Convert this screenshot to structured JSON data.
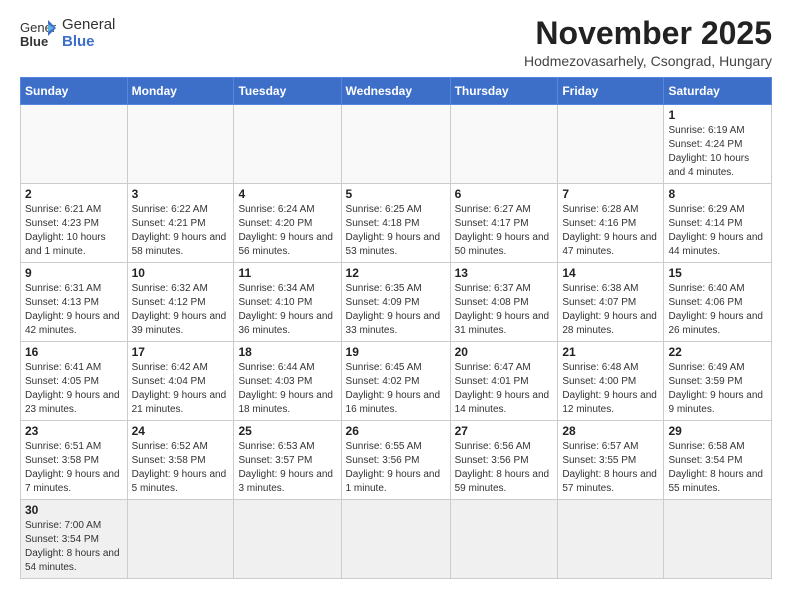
{
  "logo": {
    "text_normal": "General",
    "text_bold": "Blue"
  },
  "header": {
    "month": "November 2025",
    "location": "Hodmezovasarhely, Csongrad, Hungary"
  },
  "weekdays": [
    "Sunday",
    "Monday",
    "Tuesday",
    "Wednesday",
    "Thursday",
    "Friday",
    "Saturday"
  ],
  "weeks": [
    [
      {
        "day": "",
        "info": ""
      },
      {
        "day": "",
        "info": ""
      },
      {
        "day": "",
        "info": ""
      },
      {
        "day": "",
        "info": ""
      },
      {
        "day": "",
        "info": ""
      },
      {
        "day": "",
        "info": ""
      },
      {
        "day": "1",
        "info": "Sunrise: 6:19 AM\nSunset: 4:24 PM\nDaylight: 10 hours and 4 minutes."
      }
    ],
    [
      {
        "day": "2",
        "info": "Sunrise: 6:21 AM\nSunset: 4:23 PM\nDaylight: 10 hours and 1 minute."
      },
      {
        "day": "3",
        "info": "Sunrise: 6:22 AM\nSunset: 4:21 PM\nDaylight: 9 hours and 58 minutes."
      },
      {
        "day": "4",
        "info": "Sunrise: 6:24 AM\nSunset: 4:20 PM\nDaylight: 9 hours and 56 minutes."
      },
      {
        "day": "5",
        "info": "Sunrise: 6:25 AM\nSunset: 4:18 PM\nDaylight: 9 hours and 53 minutes."
      },
      {
        "day": "6",
        "info": "Sunrise: 6:27 AM\nSunset: 4:17 PM\nDaylight: 9 hours and 50 minutes."
      },
      {
        "day": "7",
        "info": "Sunrise: 6:28 AM\nSunset: 4:16 PM\nDaylight: 9 hours and 47 minutes."
      },
      {
        "day": "8",
        "info": "Sunrise: 6:29 AM\nSunset: 4:14 PM\nDaylight: 9 hours and 44 minutes."
      }
    ],
    [
      {
        "day": "9",
        "info": "Sunrise: 6:31 AM\nSunset: 4:13 PM\nDaylight: 9 hours and 42 minutes."
      },
      {
        "day": "10",
        "info": "Sunrise: 6:32 AM\nSunset: 4:12 PM\nDaylight: 9 hours and 39 minutes."
      },
      {
        "day": "11",
        "info": "Sunrise: 6:34 AM\nSunset: 4:10 PM\nDaylight: 9 hours and 36 minutes."
      },
      {
        "day": "12",
        "info": "Sunrise: 6:35 AM\nSunset: 4:09 PM\nDaylight: 9 hours and 33 minutes."
      },
      {
        "day": "13",
        "info": "Sunrise: 6:37 AM\nSunset: 4:08 PM\nDaylight: 9 hours and 31 minutes."
      },
      {
        "day": "14",
        "info": "Sunrise: 6:38 AM\nSunset: 4:07 PM\nDaylight: 9 hours and 28 minutes."
      },
      {
        "day": "15",
        "info": "Sunrise: 6:40 AM\nSunset: 4:06 PM\nDaylight: 9 hours and 26 minutes."
      }
    ],
    [
      {
        "day": "16",
        "info": "Sunrise: 6:41 AM\nSunset: 4:05 PM\nDaylight: 9 hours and 23 minutes."
      },
      {
        "day": "17",
        "info": "Sunrise: 6:42 AM\nSunset: 4:04 PM\nDaylight: 9 hours and 21 minutes."
      },
      {
        "day": "18",
        "info": "Sunrise: 6:44 AM\nSunset: 4:03 PM\nDaylight: 9 hours and 18 minutes."
      },
      {
        "day": "19",
        "info": "Sunrise: 6:45 AM\nSunset: 4:02 PM\nDaylight: 9 hours and 16 minutes."
      },
      {
        "day": "20",
        "info": "Sunrise: 6:47 AM\nSunset: 4:01 PM\nDaylight: 9 hours and 14 minutes."
      },
      {
        "day": "21",
        "info": "Sunrise: 6:48 AM\nSunset: 4:00 PM\nDaylight: 9 hours and 12 minutes."
      },
      {
        "day": "22",
        "info": "Sunrise: 6:49 AM\nSunset: 3:59 PM\nDaylight: 9 hours and 9 minutes."
      }
    ],
    [
      {
        "day": "23",
        "info": "Sunrise: 6:51 AM\nSunset: 3:58 PM\nDaylight: 9 hours and 7 minutes."
      },
      {
        "day": "24",
        "info": "Sunrise: 6:52 AM\nSunset: 3:58 PM\nDaylight: 9 hours and 5 minutes."
      },
      {
        "day": "25",
        "info": "Sunrise: 6:53 AM\nSunset: 3:57 PM\nDaylight: 9 hours and 3 minutes."
      },
      {
        "day": "26",
        "info": "Sunrise: 6:55 AM\nSunset: 3:56 PM\nDaylight: 9 hours and 1 minute."
      },
      {
        "day": "27",
        "info": "Sunrise: 6:56 AM\nSunset: 3:56 PM\nDaylight: 8 hours and 59 minutes."
      },
      {
        "day": "28",
        "info": "Sunrise: 6:57 AM\nSunset: 3:55 PM\nDaylight: 8 hours and 57 minutes."
      },
      {
        "day": "29",
        "info": "Sunrise: 6:58 AM\nSunset: 3:54 PM\nDaylight: 8 hours and 55 minutes."
      }
    ],
    [
      {
        "day": "30",
        "info": "Sunrise: 7:00 AM\nSunset: 3:54 PM\nDaylight: 8 hours and 54 minutes."
      },
      {
        "day": "",
        "info": ""
      },
      {
        "day": "",
        "info": ""
      },
      {
        "day": "",
        "info": ""
      },
      {
        "day": "",
        "info": ""
      },
      {
        "day": "",
        "info": ""
      },
      {
        "day": "",
        "info": ""
      }
    ]
  ]
}
